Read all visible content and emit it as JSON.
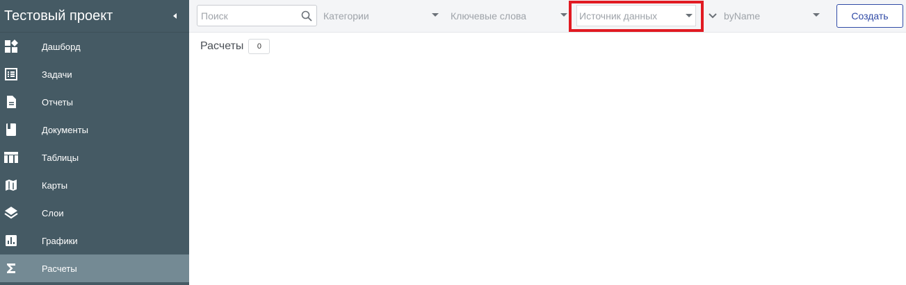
{
  "sidebar": {
    "title": "Тестовый проект",
    "items": [
      {
        "label": "Дашборд",
        "icon": "dashboard-icon"
      },
      {
        "label": "Задачи",
        "icon": "tasks-icon"
      },
      {
        "label": "Отчеты",
        "icon": "report-icon"
      },
      {
        "label": "Документы",
        "icon": "document-icon"
      },
      {
        "label": "Таблицы",
        "icon": "table-icon"
      },
      {
        "label": "Карты",
        "icon": "map-icon"
      },
      {
        "label": "Слои",
        "icon": "layers-icon"
      },
      {
        "label": "Графики",
        "icon": "chart-icon"
      },
      {
        "label": "Расчеты",
        "icon": "sigma-icon",
        "active": true
      }
    ]
  },
  "toolbar": {
    "search_placeholder": "Поиск",
    "categories_label": "Категории",
    "keywords_label": "Ключевые слова",
    "source_label": "Источник данных",
    "sort_label": "byName",
    "create_label": "Создать"
  },
  "content": {
    "section_title": "Расчеты",
    "count": "0"
  },
  "colors": {
    "sidebar_bg": "#455a64",
    "sidebar_active": "#748a94",
    "accent": "#2f4aa6",
    "highlight": "#e11a22"
  }
}
